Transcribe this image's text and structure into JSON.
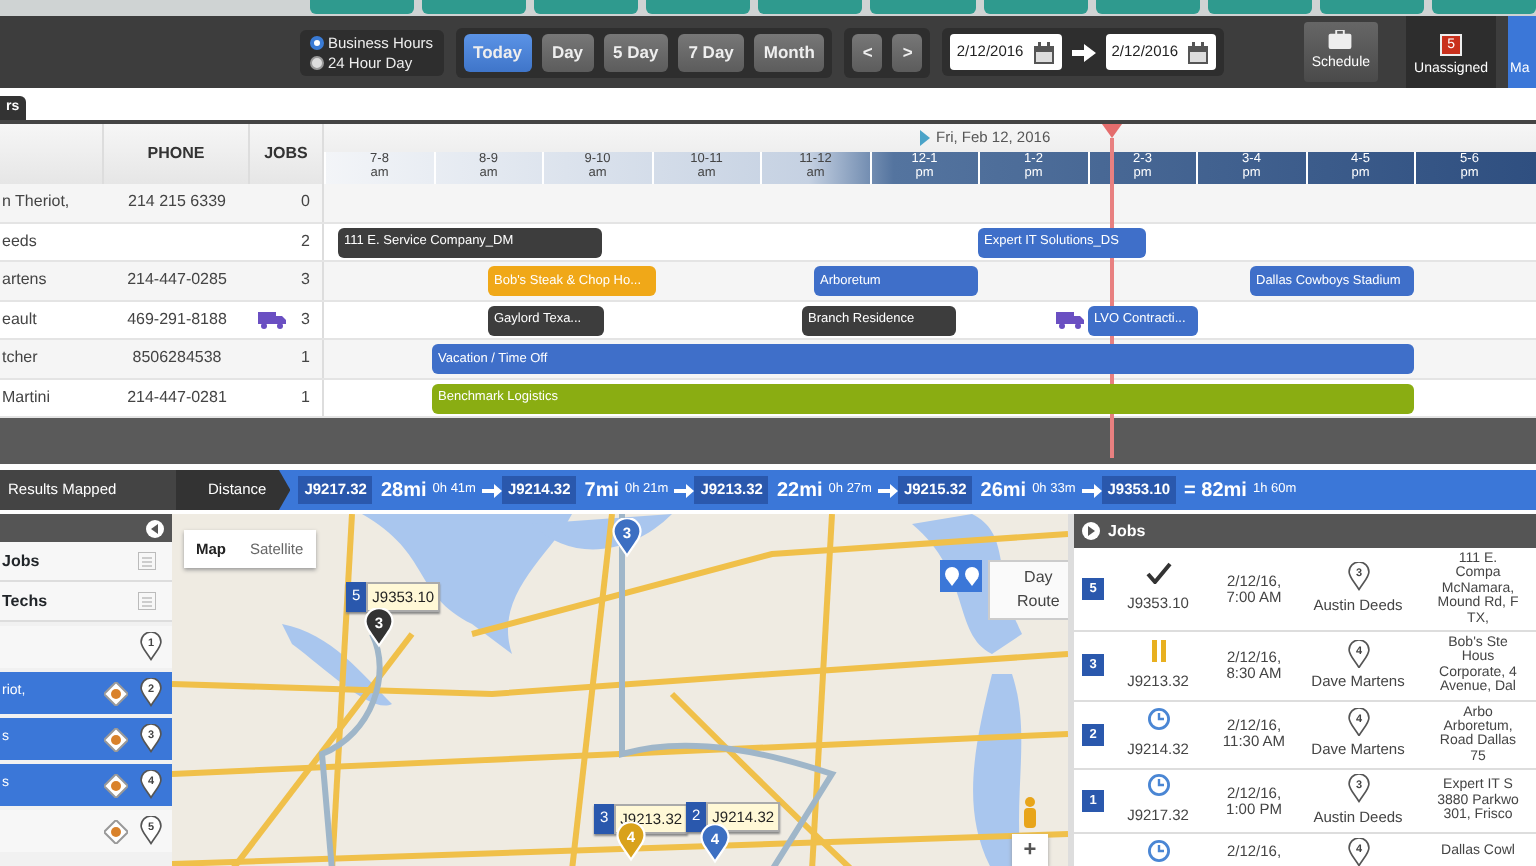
{
  "toolbar": {
    "hours_options": [
      {
        "label": "Business Hours",
        "selected": true
      },
      {
        "label": "24 Hour Day",
        "selected": false
      }
    ],
    "range_buttons": [
      {
        "label": "Today",
        "selected": true
      },
      {
        "label": "Day",
        "selected": false
      },
      {
        "label": "5 Day",
        "selected": false
      },
      {
        "label": "7 Day",
        "selected": false
      },
      {
        "label": "Month",
        "selected": false
      }
    ],
    "prev": "<",
    "next": ">",
    "start_date": "2/12/2016",
    "end_date": "2/12/2016",
    "schedule_button": "Schedule",
    "unassigned": {
      "label": "Unassigned",
      "count": "5"
    },
    "map_tab": {
      "label": "Ma",
      "selected": true
    }
  },
  "side_tab": "rs",
  "schedule": {
    "columns": [
      "PHONE",
      "JOBS"
    ],
    "date": "Fri, Feb 12, 2016",
    "hours": [
      {
        "range": "7-8",
        "period": "am"
      },
      {
        "range": "8-9",
        "period": "am"
      },
      {
        "range": "9-10",
        "period": "am"
      },
      {
        "range": "10-11",
        "period": "am"
      },
      {
        "range": "11-12",
        "period": "am"
      },
      {
        "range": "12-1",
        "period": "pm"
      },
      {
        "range": "1-2",
        "period": "pm"
      },
      {
        "range": "2-3",
        "period": "pm"
      },
      {
        "range": "3-4",
        "period": "pm"
      },
      {
        "range": "4-5",
        "period": "pm"
      },
      {
        "range": "5-6",
        "period": "pm"
      }
    ],
    "rows": [
      {
        "name": "n Theriot,",
        "phone": "214 215 6339",
        "truck": false,
        "jobs": "0",
        "events": []
      },
      {
        "name": "eeds",
        "truck": false,
        "jobs": "2",
        "events": [
          {
            "label": "111 E. Service Company_DM",
            "color": "#3d3d3d",
            "truck": false
          },
          {
            "label": "Expert IT Solutions_DS",
            "color": "#3f6fc9",
            "truck": false
          }
        ]
      },
      {
        "name": "artens",
        "phone": "214-447-0285",
        "truck": false,
        "jobs": "3",
        "events": [
          {
            "label": "Bob's Steak & Chop Ho...",
            "color": "#f0a818",
            "truck": false
          },
          {
            "label": "Arboretum",
            "color": "#3f6fc9",
            "truck": false
          },
          {
            "label": "Dallas Cowboys Stadium",
            "color": "#3f6fc9",
            "truck": false
          }
        ]
      },
      {
        "name": "eault",
        "phone": "469-291-8188",
        "truck": true,
        "jobs": "3",
        "events": [
          {
            "label": "Gaylord Texa...",
            "color": "#3d3d3d",
            "truck": false
          },
          {
            "label": "Branch Residence",
            "color": "#3d3d3d",
            "truck": false
          },
          {
            "label": "LVO Contracti...",
            "color": "#3f6fc9",
            "truck": true
          }
        ]
      },
      {
        "name": "tcher",
        "phone": "8506284538",
        "truck": false,
        "jobs": "1",
        "events": [
          {
            "label": "Vacation / Time Off",
            "color": "#3f6fc9",
            "truck": false
          }
        ]
      },
      {
        "name": "Martini",
        "phone": "214-447-0281",
        "truck": false,
        "jobs": "1",
        "events": [
          {
            "label": "Benchmark Logistics",
            "color": "#8aad12",
            "truck": false
          }
        ]
      }
    ]
  },
  "route": {
    "results_label": "Results Mapped",
    "distance_label": "Distance",
    "stops": [
      {
        "job": "J9217.32",
        "distance": "28mi",
        "time": "0h 41m"
      },
      {
        "job": "J9214.32",
        "distance": "7mi",
        "time": "0h 21m"
      },
      {
        "job": "J9213.32",
        "distance": "22mi",
        "time": "0h 27m"
      },
      {
        "job": "J9215.32",
        "distance": "26mi",
        "time": "0h 33m"
      },
      {
        "job": "J9353.10"
      }
    ],
    "total_distance": "= 82mi",
    "total_time": "1h 60m"
  },
  "left_panel": {
    "filters": [
      {
        "label": "Jobs"
      },
      {
        "label": "Techs"
      }
    ],
    "techs": [
      {
        "pin": "1",
        "selected": false,
        "target": false
      },
      {
        "name": "riot,",
        "pin": "2",
        "selected": true,
        "target": true
      },
      {
        "name": "s",
        "pin": "3",
        "selected": true,
        "target": true
      },
      {
        "name": "s",
        "pin": "4",
        "selected": true,
        "target": true
      },
      {
        "pin": "5",
        "selected": false,
        "target": true
      }
    ]
  },
  "map": {
    "view_options": [
      {
        "label": "Map",
        "selected": true
      },
      {
        "label": "Satellite",
        "selected": false
      }
    ],
    "day_route": "Day Route",
    "job_labels": [
      {
        "order": "5",
        "job": "J9353.10"
      },
      {
        "order": "3",
        "job": "J9213.32"
      },
      {
        "order": "2",
        "job": "J9214.32"
      }
    ],
    "pins": [
      {
        "number": "3",
        "color": "#333333"
      },
      {
        "number": "3",
        "color": "#3c6fc2"
      },
      {
        "number": "4",
        "color": "#d9a21b"
      },
      {
        "number": "4",
        "color": "#3c6fc2"
      }
    ],
    "zoom_in": "+"
  },
  "jobs_panel": {
    "title": "Jobs",
    "jobs": [
      {
        "order": "5",
        "kind": "done",
        "job": "J9353.10",
        "when": "2/12/16, 7:00 AM",
        "tech_pin": "3",
        "tech": "Austin Deeds",
        "address": [
          "111 E.",
          "Compa",
          "McNamara,",
          "Mound Rd, F",
          "TX,"
        ]
      },
      {
        "order": "3",
        "kind": "paused",
        "job": "J9213.32",
        "when": "2/12/16, 8:30 AM",
        "tech_pin": "4",
        "tech": "Dave Martens",
        "address": [
          "Bob's Ste",
          "Hous",
          "Corporate, 4",
          "Avenue, Dal"
        ]
      },
      {
        "order": "2",
        "kind": "scheduled",
        "job": "J9214.32",
        "when": "2/12/16, 11:30 AM",
        "tech_pin": "4",
        "tech": "Dave Martens",
        "address": [
          "Arbo",
          "Arboretum,",
          "Road Dallas",
          "75"
        ]
      },
      {
        "order": "1",
        "kind": "scheduled",
        "job": "J9217.32",
        "when": "2/12/16, 1:00 PM",
        "tech_pin": "3",
        "tech": "Austin Deeds",
        "address": [
          "Expert IT S",
          "3880 Parkwo",
          "301, Frisco"
        ]
      },
      {
        "kind": "scheduled",
        "when": "2/12/16,",
        "tech_pin": "4",
        "address": [
          "Dallas Cowl"
        ]
      }
    ]
  }
}
